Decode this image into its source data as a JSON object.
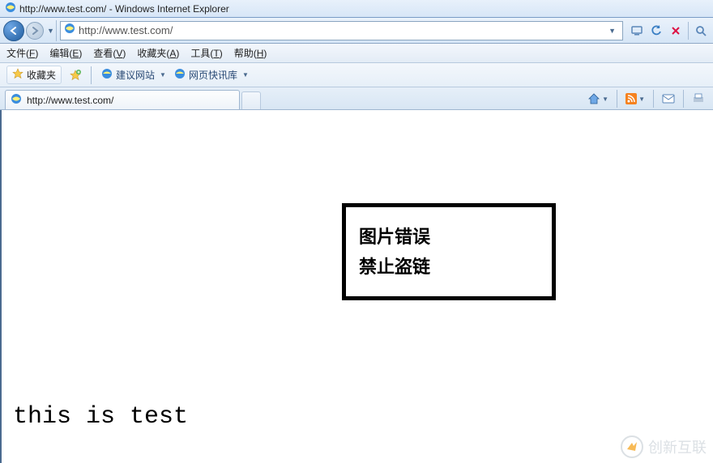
{
  "window": {
    "title": "http://www.test.com/ - Windows Internet Explorer"
  },
  "address": {
    "url_prefix": "http://www.",
    "url_domain": "test",
    "url_suffix": ".com/",
    "full": "http://www.test.com/"
  },
  "menus": {
    "file": "文件(F)",
    "edit": "编辑(E)",
    "view": "查看(V)",
    "favorites": "收藏夹(A)",
    "tools": "工具(T)",
    "help": "帮助(H)"
  },
  "linksbar": {
    "favorites_label": "收藏夹",
    "suggested_sites": "建议网站",
    "web_slices": "网页快讯库"
  },
  "tab": {
    "title": "http://www.test.com/"
  },
  "content": {
    "error_line1": "图片错误",
    "error_line2": "禁止盗链",
    "page_text": "this is test"
  },
  "watermark": {
    "text": "创新互联"
  }
}
